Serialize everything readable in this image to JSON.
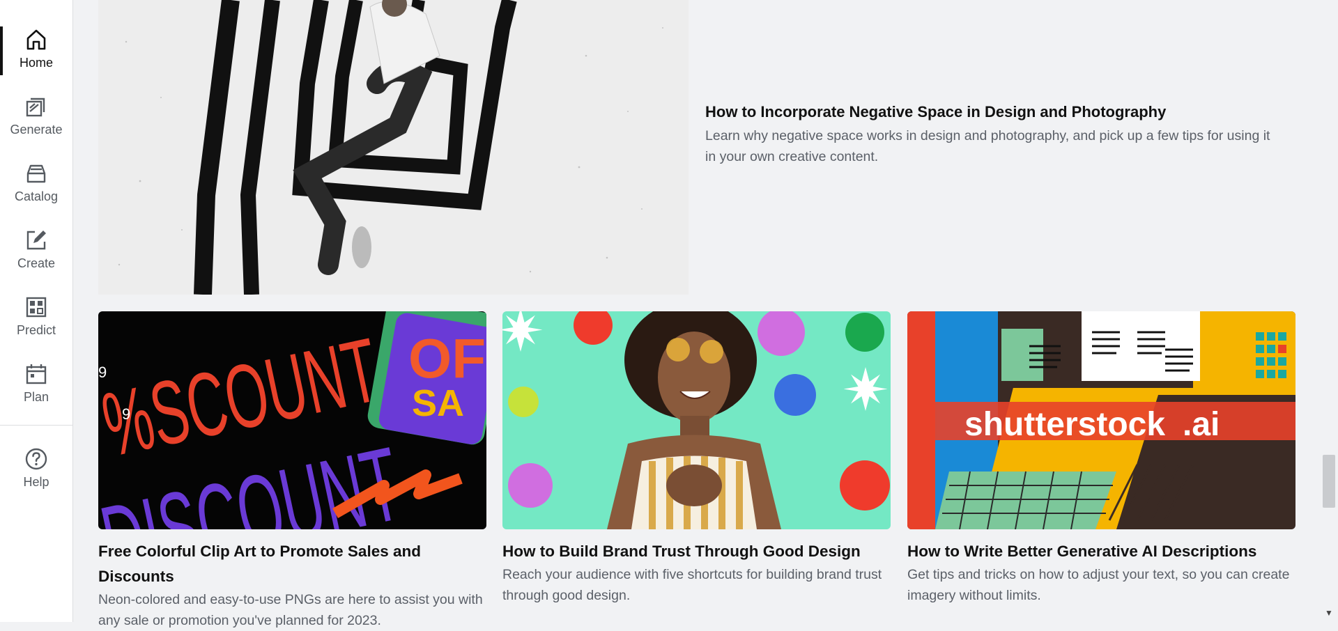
{
  "sidebar": {
    "items": [
      {
        "label": "Home",
        "icon": "home-icon",
        "active": true
      },
      {
        "label": "Generate",
        "icon": "generate-icon"
      },
      {
        "label": "Catalog",
        "icon": "catalog-icon"
      },
      {
        "label": "Create",
        "icon": "create-icon"
      },
      {
        "label": "Predict",
        "icon": "predict-icon"
      },
      {
        "label": "Plan",
        "icon": "plan-icon"
      },
      {
        "label": "Help",
        "icon": "help-icon"
      }
    ]
  },
  "featured": {
    "title": "How to Incorporate Negative Space in Design and Photography",
    "description": "Learn why negative space works in design and photography, and pick up a few tips for using it in your own creative content."
  },
  "cards": [
    {
      "title": "Free Colorful Clip Art to Promote Sales and Discounts",
      "description": "Neon-colored and easy-to-use PNGs are here to assist you with any sale or promotion you've planned for 2023.",
      "image_text": [
        "%SCOUNT",
        "DISCOUNT",
        "OF",
        "SA",
        "9"
      ]
    },
    {
      "title": "How to Build Brand Trust Through Good Design",
      "description": "Reach your audience with five shortcuts for building brand trust through good design."
    },
    {
      "title": "How to Write Better Generative AI Descriptions",
      "description": "Get tips and tricks on how to adjust your text, so you can create imagery without limits.",
      "image_text": [
        "shutterstock",
        ".ai"
      ]
    }
  ],
  "colors": {
    "background": "#f1f2f4",
    "sidebar": "#ffffff",
    "accent_dark": "#111111",
    "muted_text": "#5b6068"
  }
}
